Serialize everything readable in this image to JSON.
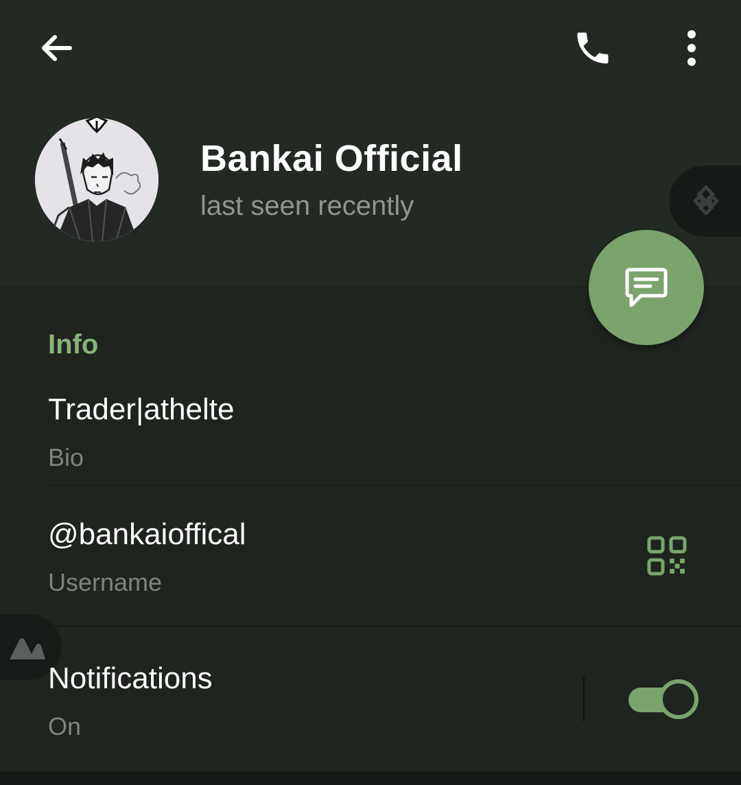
{
  "topbar": {
    "back_icon": "arrow-left-icon",
    "call_icon": "phone-icon",
    "more_icon": "more-vertical-icon"
  },
  "profile": {
    "name": "Bankai Official",
    "status": "last seen recently",
    "avatar": "anime-swordsman-avatar"
  },
  "fab": {
    "icon": "message-icon"
  },
  "info": {
    "section_title": "Info",
    "bio_value": "Trader|athelte",
    "bio_label": "Bio",
    "username_value": "@bankaioffical",
    "username_label": "Username",
    "qr_icon": "qr-code-icon"
  },
  "notifications": {
    "label": "Notifications",
    "state": "On",
    "enabled": true
  },
  "overlays": {
    "right_pill_icon": "diamond-logo-icon",
    "left_pill_icon": "mountain-logo-icon"
  },
  "colors": {
    "accent": "#7aa46c",
    "section_title": "#86b377",
    "header_bg": "#232a23",
    "body_bg": "#1f241f"
  }
}
